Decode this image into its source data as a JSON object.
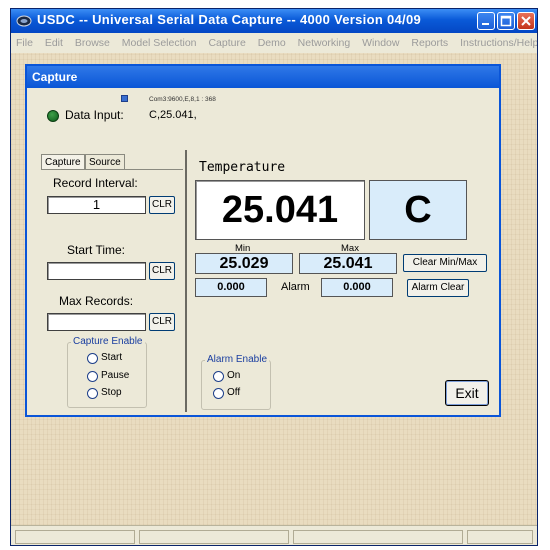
{
  "window": {
    "title": "USDC -- Universal Serial Data Capture -- 4000   Version 04/09"
  },
  "menu": {
    "items": [
      "File",
      "Edit",
      "Browse",
      "Model Selection",
      "Capture",
      "Demo",
      "Networking",
      "Window",
      "Reports",
      "Instructions/Help"
    ]
  },
  "capture_window": {
    "title": "Capture",
    "data_input_label": "Data Input:",
    "com_settings": "Com3:9600,E,8,1 : 368",
    "data_input_value": "C,25.041,"
  },
  "tabs": [
    {
      "label": "Capture",
      "active": true
    },
    {
      "label": "Source",
      "active": false
    }
  ],
  "left_panel": {
    "record_interval_label": "Record Interval:",
    "record_interval_value": "1",
    "start_time_label": "Start Time:",
    "start_time_value": "",
    "max_records_label": "Max Records:",
    "max_records_value": "",
    "clr_label": "CLR",
    "capture_enable_title": "Capture Enable",
    "capture_options": [
      "Start",
      "Pause",
      "Stop"
    ]
  },
  "reading": {
    "title": "Temperature",
    "value": "25.041",
    "unit": "C",
    "min_label": "Min",
    "max_label": "Max",
    "min_value": "25.029",
    "max_value": "25.041",
    "clear_minmax_label": "Clear Min/Max",
    "alarm_low_value": "0.000",
    "alarm_label": "Alarm",
    "alarm_high_value": "0.000",
    "alarm_clear_label": "Alarm Clear"
  },
  "alarm_enable": {
    "title": "Alarm Enable",
    "options": [
      "On",
      "Off"
    ]
  },
  "exit_label": "Exit",
  "colors": {
    "titlebar": "#0a5ad8",
    "display_bg": "#d9ecfa",
    "led": "#1f7a2e"
  }
}
